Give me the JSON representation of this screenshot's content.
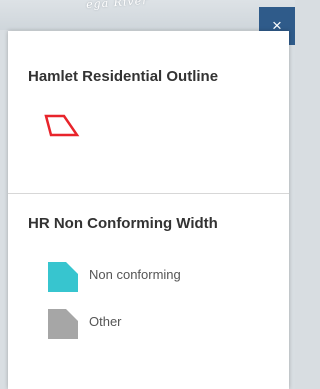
{
  "map": {
    "river_label": "ega River"
  },
  "close_button": {
    "label": "×"
  },
  "legend": {
    "layers": [
      {
        "title": "Hamlet Residential Outline",
        "symbol": {
          "type": "outline",
          "color": "#e8242b"
        }
      },
      {
        "title": "HR Non Conforming Width",
        "items": [
          {
            "label": "Non conforming",
            "color": "#37c5cf"
          },
          {
            "label": "Other",
            "color": "#a6a6a6"
          }
        ]
      }
    ]
  }
}
